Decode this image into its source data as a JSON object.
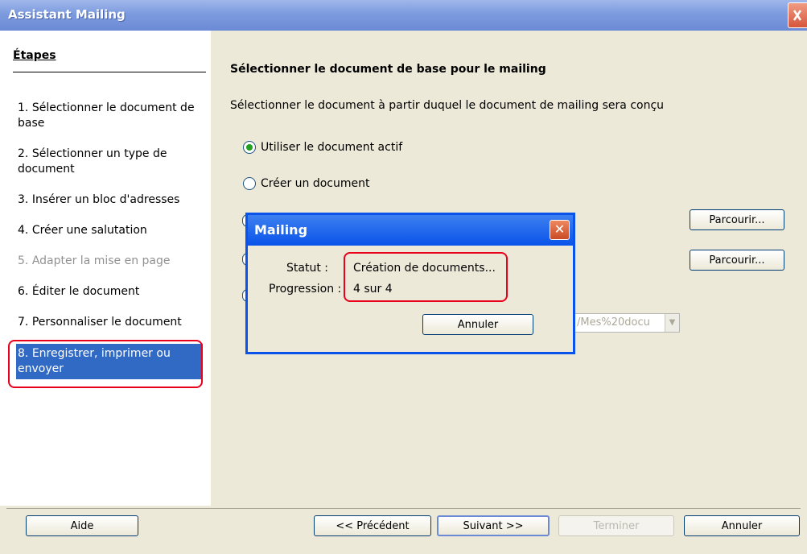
{
  "window": {
    "title": "Assistant Mailing",
    "close_icon": "close-icon"
  },
  "sidebar": {
    "title": "Étapes",
    "steps": [
      {
        "num": "1.",
        "label": "Sélectionner le document de base",
        "state": "normal"
      },
      {
        "num": "2.",
        "label": "Sélectionner un type de document",
        "state": "normal"
      },
      {
        "num": "3.",
        "label": "Insérer un bloc d'adresses",
        "state": "normal"
      },
      {
        "num": "4.",
        "label": "Créer une salutation",
        "state": "normal"
      },
      {
        "num": "5.",
        "label": "Adapter la mise en page",
        "state": "disabled"
      },
      {
        "num": "6.",
        "label": "Éditer le document",
        "state": "normal"
      },
      {
        "num": "7.",
        "label": "Personnaliser le document",
        "state": "normal"
      },
      {
        "num": "8.",
        "label": "Enregistrer, imprimer ou envoyer",
        "state": "active"
      }
    ]
  },
  "main": {
    "title": "Sélectionner le document de base pour le mailing",
    "description": "Sélectionner le document à partir duquel le document de mailing sera conçu",
    "radio_active": "Utiliser le document actif",
    "radio_create": "Créer un document",
    "browse1": "Parcourir...",
    "browse2": "Parcourir...",
    "combo_value": "/Mes%20docu"
  },
  "buttons": {
    "help": "Aide",
    "previous": "<< Précédent",
    "next": "Suivant >>",
    "finish": "Terminer",
    "cancel": "Annuler"
  },
  "dialog": {
    "title": "Mailing",
    "status_label": "Statut :",
    "status_value": "Création de documents...",
    "progress_label": "Progression :",
    "progress_value": "4 sur 4",
    "cancel": "Annuler"
  },
  "colors": {
    "highlight": "#e8001c",
    "selection": "#316ac5",
    "xp_blue": "#0a53ea"
  }
}
